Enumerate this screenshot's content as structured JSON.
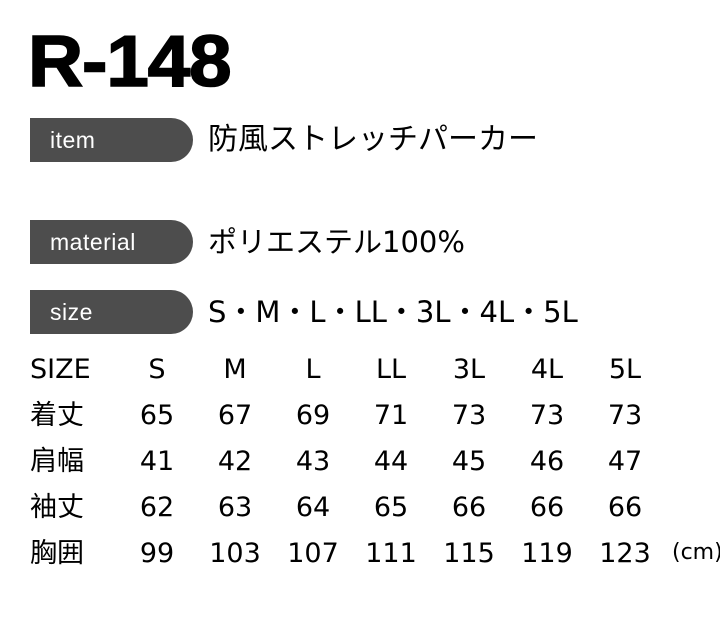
{
  "product": {
    "code": "R-148"
  },
  "specs": [
    {
      "badge": "item",
      "value": "防風ストレッチパーカー",
      "key": "item"
    },
    {
      "badge": "material",
      "value": "ポリエステル100%",
      "key": "material"
    },
    {
      "badge": "size",
      "value": "S・M・L・LL・3L・4L・5L",
      "key": "size"
    }
  ],
  "size_table": {
    "header": [
      "SIZE",
      "S",
      "M",
      "L",
      "LL",
      "3L",
      "4L",
      "5L"
    ],
    "unit": "(cm)",
    "rows": [
      {
        "label": "着丈",
        "values": [
          "65",
          "67",
          "69",
          "71",
          "73",
          "73",
          "73"
        ]
      },
      {
        "label": "肩幅",
        "values": [
          "41",
          "42",
          "43",
          "44",
          "45",
          "46",
          "47"
        ]
      },
      {
        "label": "袖丈",
        "values": [
          "62",
          "63",
          "64",
          "65",
          "66",
          "66",
          "66"
        ]
      },
      {
        "label": "胸囲",
        "values": [
          "99",
          "103",
          "107",
          "111",
          "115",
          "119",
          "123"
        ]
      }
    ]
  },
  "colors": {
    "badge_background": "#4d4d4d",
    "badge_text": "#ffffff",
    "text": "#000000",
    "page_background": "#ffffff"
  }
}
